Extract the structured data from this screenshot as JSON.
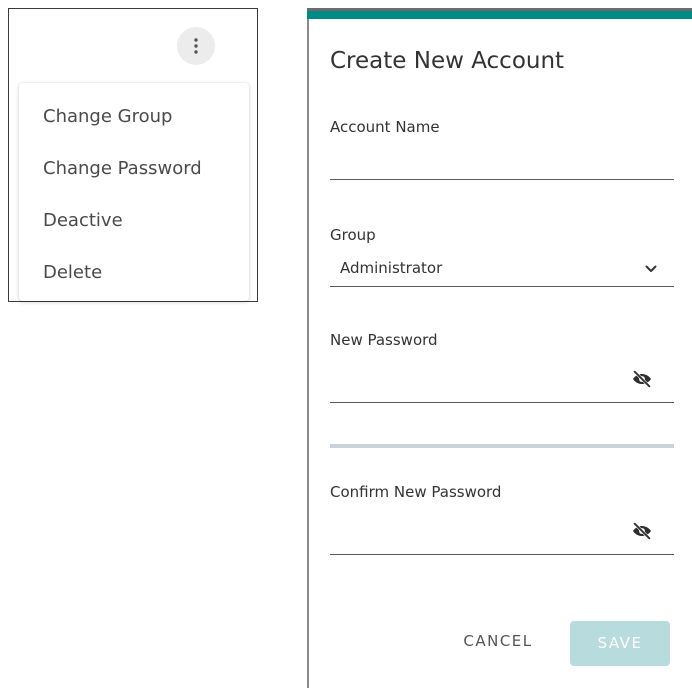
{
  "menu": {
    "items": [
      {
        "label": "Change Group"
      },
      {
        "label": "Change Password"
      },
      {
        "label": "Deactive"
      },
      {
        "label": "Delete"
      }
    ]
  },
  "dialog": {
    "title": "Create New Account",
    "account_name": {
      "label": "Account Name",
      "value": ""
    },
    "group": {
      "label": "Group",
      "selected": "Administrator"
    },
    "new_password": {
      "label": "New Password",
      "value": ""
    },
    "confirm_password": {
      "label": "Confirm New Password",
      "value": ""
    },
    "cancel_label": "CANCEL",
    "save_label": "SAVE"
  },
  "icons": {
    "more": "more-vertical-icon",
    "visibility": "eye-off-icon",
    "select": "chevron-down-icon"
  },
  "colors": {
    "accent": "#008c86",
    "save_disabled_bg": "#b8dcdd",
    "divider": "#c8d3dc"
  }
}
